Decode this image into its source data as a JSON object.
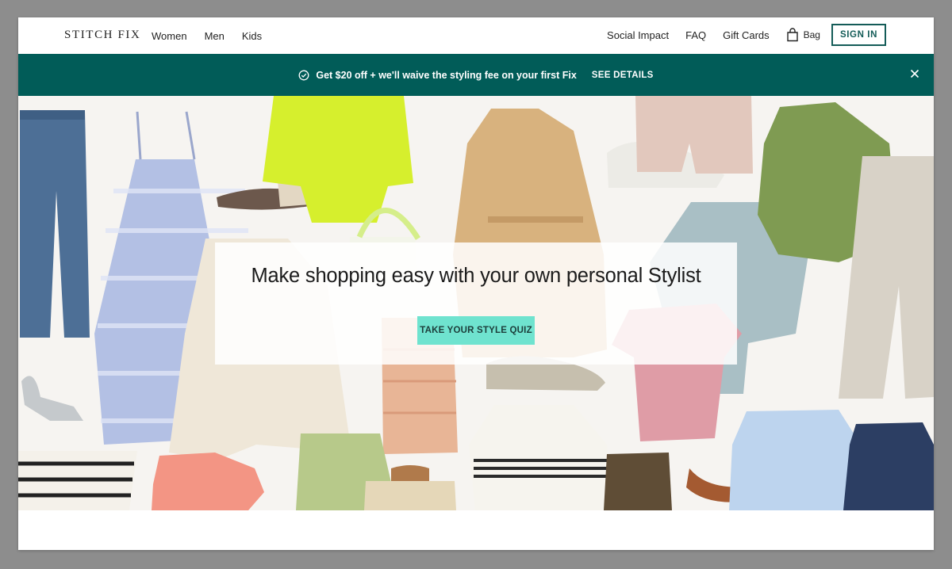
{
  "header": {
    "logo": "STITCH FIX",
    "nav_left": [
      "Women",
      "Men",
      "Kids"
    ],
    "nav_right": [
      "Social Impact",
      "FAQ",
      "Gift Cards"
    ],
    "bag_label": "Bag",
    "sign_in_label": "SIGN IN"
  },
  "promo": {
    "text": "Get $20 off + we'll waive the styling fee on your first Fix",
    "link_label": "SEE DETAILS",
    "background": "#015c58"
  },
  "hero": {
    "headline": "Make shopping easy with your own personal Stylist",
    "cta_label": "TAKE YOUR STYLE QUIZ",
    "cta_color": "#6fe3cf"
  }
}
